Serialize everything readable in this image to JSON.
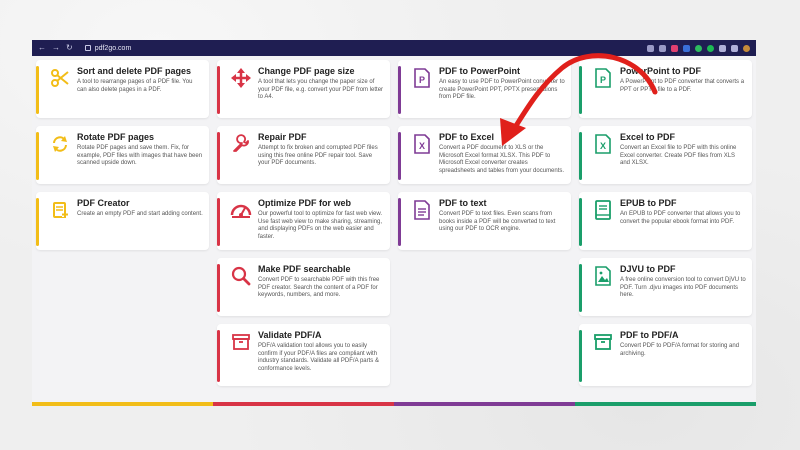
{
  "browser": {
    "url": "pdf2go.com",
    "nav_back": "←",
    "nav_forward": "→",
    "nav_reload": "↻"
  },
  "colors": {
    "yellow": "#f2bd18",
    "red": "#d83446",
    "purple": "#7f3b95",
    "green": "#1a9e6a",
    "arrow": "#e0201b"
  },
  "col1": [
    {
      "title": "Sort and delete PDF pages",
      "desc": "A tool to rearrange pages of a PDF file. You can also delete pages in a PDF.",
      "icon": "scissors-icon"
    },
    {
      "title": "Rotate PDF pages",
      "desc": "Rotate PDF pages and save them. Fix, for example, PDF files with images that have been scanned upside down.",
      "icon": "rotate-icon"
    },
    {
      "title": "PDF Creator",
      "desc": "Create an empty PDF and start adding content.",
      "icon": "pdf-creator-icon"
    }
  ],
  "col2": [
    {
      "title": "Change PDF page size",
      "desc": "A tool that lets you change the paper size of your PDF file, e.g. convert your PDF from letter to A4.",
      "icon": "resize-arrows-icon"
    },
    {
      "title": "Repair PDF",
      "desc": "Attempt to fix broken and corrupted PDF files using this free online PDF repair tool. Save your PDF documents.",
      "icon": "wrench-icon"
    },
    {
      "title": "Optimize PDF for web",
      "desc": "Our powerful tool to optimize for fast web view. Use fast web view to make sharing, streaming, and displaying PDFs on the web easier and faster.",
      "icon": "speedometer-icon"
    },
    {
      "title": "Make PDF searchable",
      "desc": "Convert PDF to searchable PDF with this free PDF creator. Search the content of a PDF for keywords, numbers, and more.",
      "icon": "magnifier-icon"
    },
    {
      "title": "Validate PDF/A",
      "desc": "PDF/A validation tool allows you to easily confirm if your PDF/A files are compliant with industry standards. Validate all PDF/A parts & conformance levels.",
      "icon": "archive-icon"
    }
  ],
  "col3": [
    {
      "title": "PDF to PowerPoint",
      "desc": "An easy to use PDF to PowerPoint converter to create PowerPoint PPT, PPTX presentations from PDF file.",
      "icon": "powerpoint-file-icon",
      "glyph": "P"
    },
    {
      "title": "PDF to Excel",
      "desc": "Convert a PDF document to XLS or the Microsoft Excel format XLSX. This PDF to Microsoft Excel converter creates spreadsheets and tables from your documents.",
      "icon": "excel-file-icon",
      "glyph": "X"
    },
    {
      "title": "PDF to text",
      "desc": "Convert PDF to text files. Even scans from books inside a PDF will be converted to text using our PDF to OCR engine.",
      "icon": "text-file-icon",
      "glyph": ""
    }
  ],
  "col4": [
    {
      "title": "PowerPoint to PDF",
      "desc": "A PowerPoint to PDF converter that converts a PPT or PPTX file to a PDF.",
      "icon": "powerpoint-file-icon",
      "glyph": "P"
    },
    {
      "title": "Excel to PDF",
      "desc": "Convert an Excel file to PDF with this online Excel converter. Create PDF files from XLS and XLSX.",
      "icon": "excel-file-icon",
      "glyph": "X"
    },
    {
      "title": "EPUB to PDF",
      "desc": "An EPUB to PDF converter that allows you to convert the popular ebook format into PDF.",
      "icon": "book-icon"
    },
    {
      "title": "DJVU to PDF",
      "desc": "A free online conversion tool to convert DjVU to PDF. Turn .djvu images into PDF documents here.",
      "icon": "image-file-icon"
    },
    {
      "title": "PDF to PDF/A",
      "desc": "Convert PDF to PDF/A format for storing and archiving.",
      "icon": "archive-icon"
    }
  ]
}
